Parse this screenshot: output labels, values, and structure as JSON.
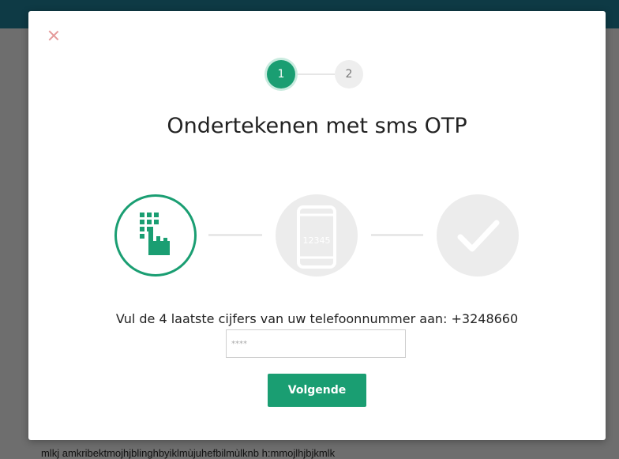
{
  "background": {
    "text": "mlkj amkribektmojhjblinghbyiklmùjuhefbilmùlknb h:mmojlhjbjkmlk"
  },
  "modal": {
    "close_icon": "close-icon",
    "stepper": {
      "steps": [
        "1",
        "2"
      ],
      "active": 1
    },
    "title": "Ondertekenen met sms OTP",
    "icons": [
      "keypad-icon",
      "phone-icon",
      "checkmark-icon"
    ],
    "phone_code": "12345",
    "prompt": "Vul de 4 laatste cijfers van uw telefoonnummer aan: +3248660",
    "input": {
      "placeholder": "****",
      "value": ""
    },
    "next_label": "Volgende"
  },
  "colors": {
    "accent": "#1a9e72",
    "topbar": "#0e3a45",
    "close": "#e49a9a"
  }
}
